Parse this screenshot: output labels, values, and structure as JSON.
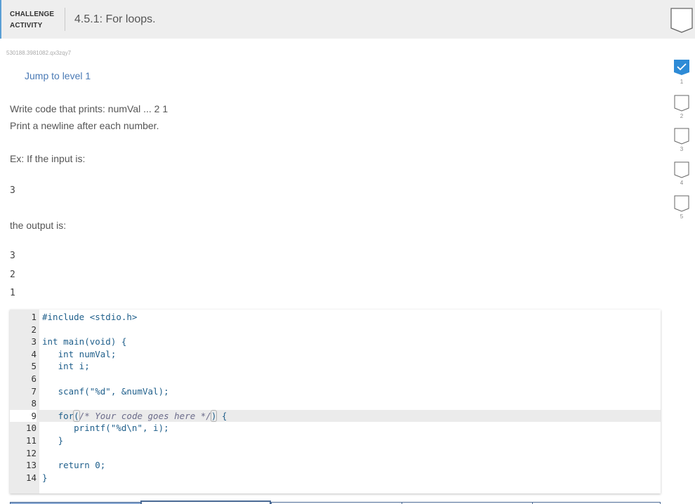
{
  "header": {
    "label_line1": "CHALLENGE",
    "label_line2": "ACTIVITY",
    "title": "4.5.1: For loops.",
    "completion_badge": "incomplete"
  },
  "activity_id": "530188.3981082.qx3zqy7",
  "jump_link": "Jump to level 1",
  "prompt": {
    "line1": "Write code that prints: numVal ... 2 1",
    "line2": "Print a newline after each number.",
    "example_intro": "Ex: If the input is:",
    "example_input": "3",
    "output_intro": "the output is:",
    "example_output": [
      "3",
      "2",
      "1"
    ]
  },
  "levels": [
    {
      "number": "1",
      "status": "complete"
    },
    {
      "number": "2",
      "status": "incomplete"
    },
    {
      "number": "3",
      "status": "incomplete"
    },
    {
      "number": "4",
      "status": "incomplete"
    },
    {
      "number": "5",
      "status": "incomplete"
    }
  ],
  "colors": {
    "accent": "#2e8bd6",
    "link": "#4a7ab5",
    "header_bg": "#eeeeee"
  },
  "editor": {
    "active_line": 9,
    "lines": [
      {
        "n": "1",
        "text": "#include <stdio.h>"
      },
      {
        "n": "2",
        "text": ""
      },
      {
        "n": "3",
        "text": "int main(void) {"
      },
      {
        "n": "4",
        "text": "   int numVal;"
      },
      {
        "n": "5",
        "text": "   int i;"
      },
      {
        "n": "6",
        "text": ""
      },
      {
        "n": "7",
        "text": "   scanf(\"%d\", &numVal);"
      },
      {
        "n": "8",
        "text": ""
      },
      {
        "n": "9",
        "text": "   for(/* Your code goes here */) {"
      },
      {
        "n": "10",
        "text": "      printf(\"%d\\n\", i);"
      },
      {
        "n": "11",
        "text": "   }"
      },
      {
        "n": "12",
        "text": ""
      },
      {
        "n": "13",
        "text": "   return 0;"
      },
      {
        "n": "14",
        "text": "}"
      }
    ],
    "line9_parts": {
      "indent": "   ",
      "kw": "for",
      "open": "(",
      "comment": "/* Your code goes here */",
      "close": ")",
      "rest": " {"
    }
  }
}
